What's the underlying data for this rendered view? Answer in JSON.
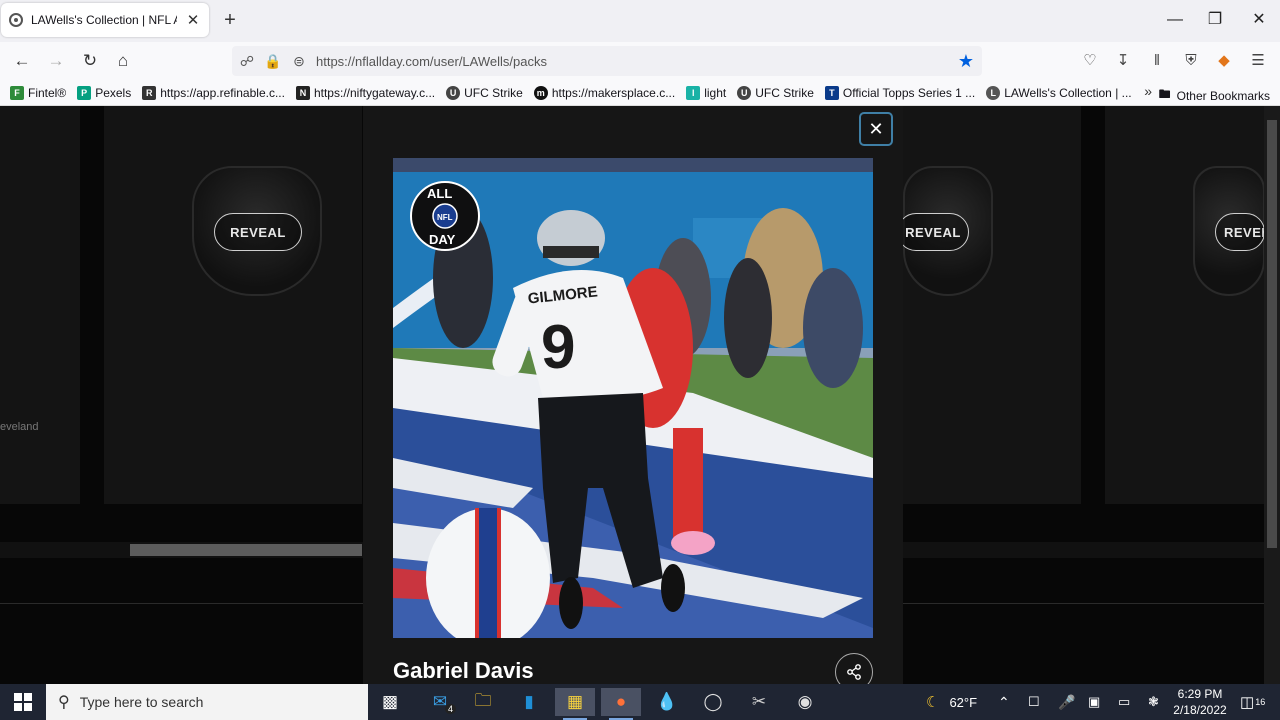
{
  "browser": {
    "tab_title": "LAWells's Collection | NFL ALL D",
    "tab_close": "✕",
    "new_tab": "+",
    "url": "https://nflallday.com/user/LAWells/packs",
    "bookmarks": [
      {
        "label": "Fintel®",
        "color": "#2e8b3a",
        "glyph": "F"
      },
      {
        "label": "Pexels",
        "color": "#05a081",
        "glyph": "P"
      },
      {
        "label": "https://app.refinable.c...",
        "color": "#333333",
        "glyph": "R"
      },
      {
        "label": "https://niftygateway.c...",
        "color": "#222222",
        "glyph": "N"
      },
      {
        "label": "UFC Strike",
        "color": "#444444",
        "glyph": "U"
      },
      {
        "label": "https://makersplace.c...",
        "color": "#111111",
        "glyph": "m"
      },
      {
        "label": "light",
        "color": "#19b2a6",
        "glyph": "l"
      },
      {
        "label": "UFC Strike",
        "color": "#444444",
        "glyph": "U"
      },
      {
        "label": "Official Topps Series 1 ...",
        "color": "#0a3a8a",
        "glyph": "T"
      },
      {
        "label": "LAWells's Collection | ...",
        "color": "#555555",
        "glyph": "L"
      }
    ],
    "other_bookmarks": "Other Bookmarks"
  },
  "page": {
    "cards": [
      {
        "reveal_label": "REVEAL"
      },
      {
        "reveal_label": "REVEAL"
      },
      {
        "reveal_label": "REVEL"
      }
    ],
    "side_label": "eveland"
  },
  "modal": {
    "close_glyph": "✕",
    "player_name": "Gabriel Davis",
    "jersey_text": "GILMORE",
    "jersey_number": "9",
    "logo_text_top": "ALL",
    "logo_text_bottom": "DAY",
    "logo_center": "NFL"
  },
  "taskbar": {
    "search_placeholder": "Type here to search",
    "mail_badge": "4",
    "weather": "62°F",
    "time": "6:29 PM",
    "date": "2/18/2022",
    "notifications": "16"
  }
}
